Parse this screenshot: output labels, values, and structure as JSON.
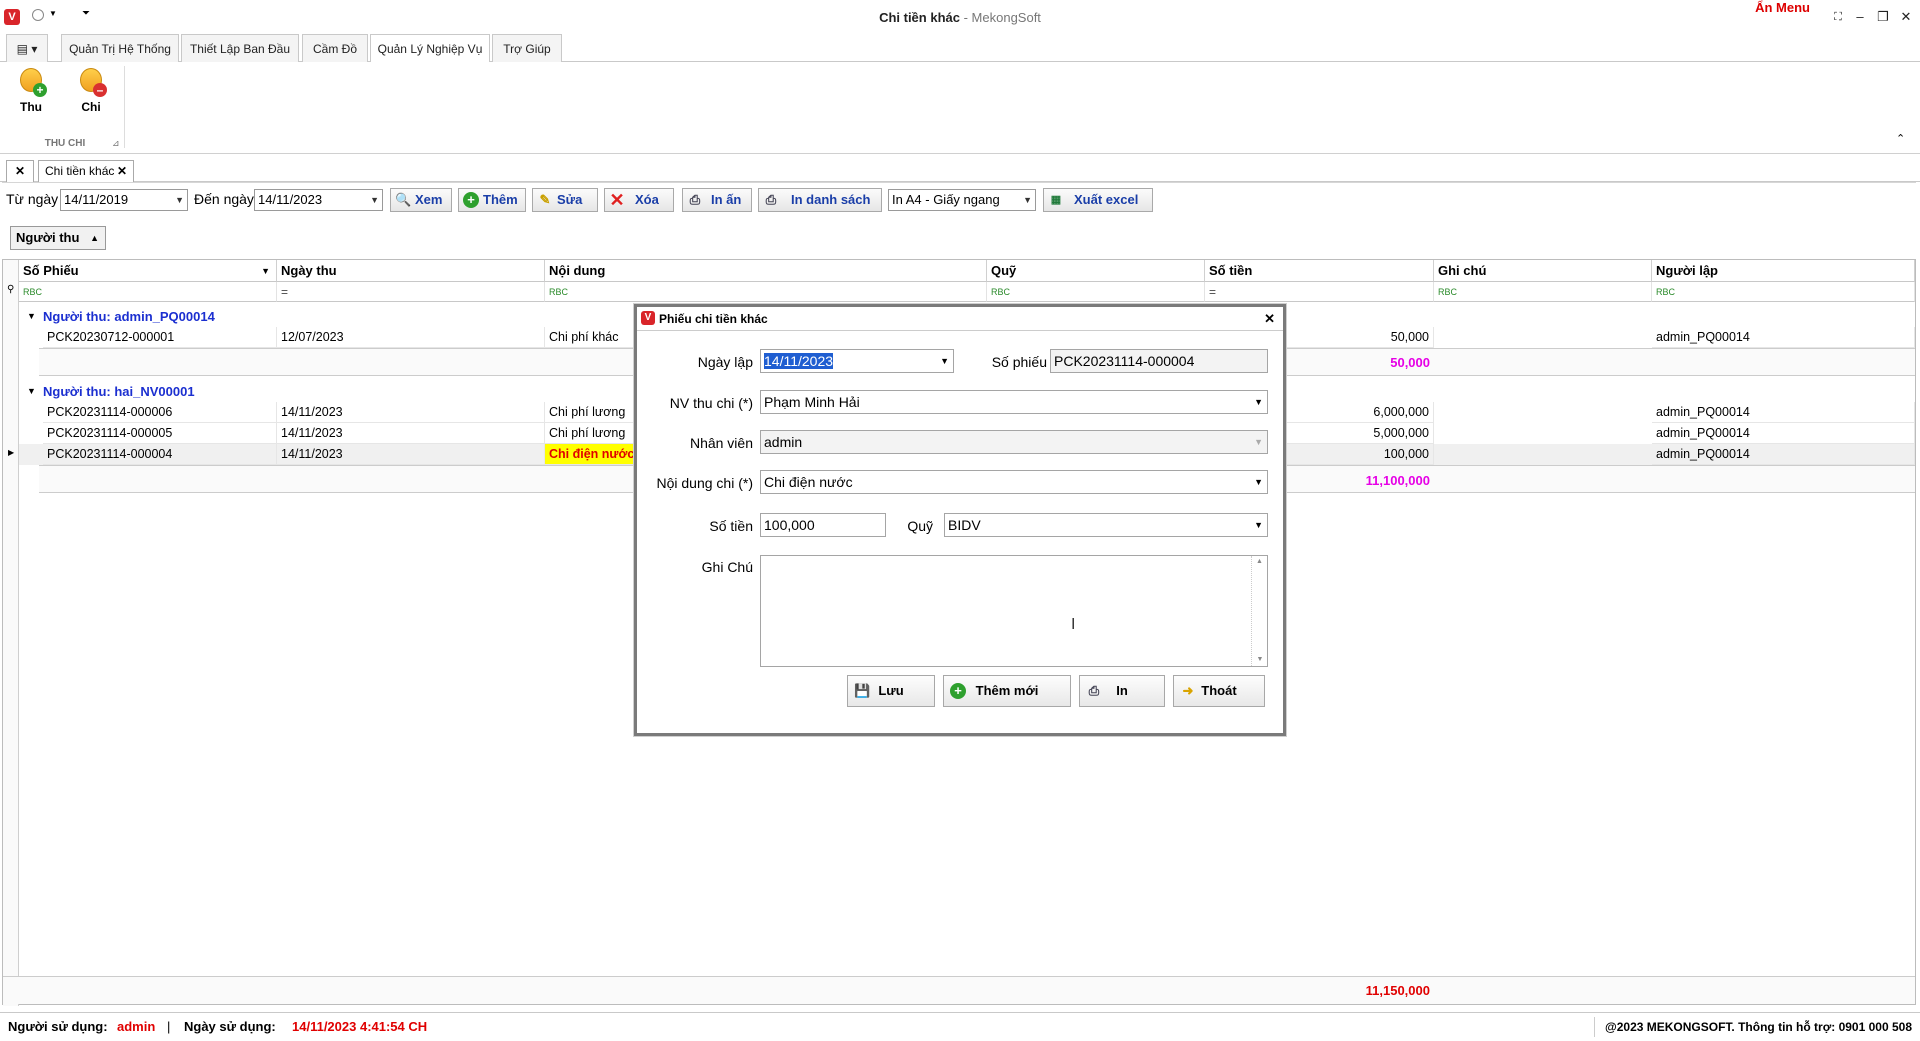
{
  "window": {
    "title": "Chi tiền khác",
    "app_name": "MekongSoft",
    "app_name_sep": " - ",
    "an_menu": "Ẩn Menu",
    "minimize": "–",
    "restore": "❐",
    "close": "✕"
  },
  "ribbon": {
    "tabs": [
      "Quản Trị Hệ Thống",
      "Thiết Lập Ban Đầu",
      "Cầm Đồ",
      "Quản Lý Nghiệp Vụ",
      "Trợ Giúp"
    ],
    "active_tab": "Quản Lý Nghiệp Vụ",
    "buttons": [
      {
        "label": "Thu"
      },
      {
        "label": "Chi"
      }
    ],
    "group_label": "THU CHI"
  },
  "doc_tabs": {
    "active": "Chi tiền khác"
  },
  "toolbar": {
    "from_label": "Từ ngày",
    "from_value": "14/11/2019",
    "to_label": "Đến ngày",
    "to_value": "14/11/2023",
    "xem": "Xem",
    "them": "Thêm",
    "sua": "Sửa",
    "xoa": "Xóa",
    "in_an": "In ấn",
    "in_danh_sach": "In danh sách",
    "print_format": "In A4 - Giấy ngang",
    "xuat_excel": "Xuất excel"
  },
  "group_by": "Người thu",
  "grid": {
    "columns": [
      "Số Phiếu",
      "Ngày thu",
      "Nội dung",
      "Quỹ",
      "Số tiền",
      "Ghi chú",
      "Người lập"
    ],
    "filter_text": "RBC",
    "filter_eq": "=",
    "groups": [
      {
        "title": "Người thu: admin_PQ00014",
        "rows": [
          {
            "so_phieu": "PCK20230712-000001",
            "ngay": "12/07/2023",
            "noi_dung": "Chi phí khác",
            "so_tien": "50,000",
            "nguoi_lap": "admin_PQ00014"
          }
        ],
        "subtotal": "50,000"
      },
      {
        "title": "Người thu: hai_NV00001",
        "rows": [
          {
            "so_phieu": "PCK20231114-000006",
            "ngay": "14/11/2023",
            "noi_dung": "Chi phí lương",
            "so_tien": "6,000,000",
            "nguoi_lap": "admin_PQ00014"
          },
          {
            "so_phieu": "PCK20231114-000005",
            "ngay": "14/11/2023",
            "noi_dung": "Chi phí lương",
            "so_tien": "5,000,000",
            "nguoi_lap": "admin_PQ00014"
          },
          {
            "so_phieu": "PCK20231114-000004",
            "ngay": "14/11/2023",
            "noi_dung": "Chi điện nước",
            "so_tien": "100,000",
            "nguoi_lap": "admin_PQ00014"
          }
        ],
        "subtotal": "11,100,000"
      }
    ],
    "grand_total": "11,150,000"
  },
  "dialog": {
    "title": "Phiếu chi tiền khác",
    "ngay_lap_label": "Ngày lập",
    "ngay_lap": "14/11/2023",
    "so_phieu_label": "Số phiếu",
    "so_phieu": "PCK20231114-000004",
    "nv_label": "NV thu chi (*)",
    "nv": "Phạm Minh Hải",
    "nhan_vien_label": "Nhân viên",
    "nhan_vien": "admin",
    "noi_dung_label": "Nội dung chi (*)",
    "noi_dung": "Chi điện nước",
    "so_tien_label": "Số tiền",
    "so_tien": "100,000",
    "quy_label": "Quỹ",
    "quy": "BIDV",
    "ghi_chu_label": "Ghi Chú",
    "btn_luu": "Lưu",
    "btn_them_moi": "Thêm mới",
    "btn_in": "In",
    "btn_thoat": "Thoát"
  },
  "status": {
    "user_label": "Người sử dụng:",
    "user": "admin",
    "sep": "|",
    "date_label": "Ngày sử dụng:",
    "date": "14/11/2023 4:41:54 CH",
    "copyright": "@2023 MEKONGSOFT. Thông tin hỗ trợ: 0901 000 508"
  },
  "colors": {
    "accent_blue": "#1b2fd0",
    "red": "#e00000",
    "magenta": "#e600e6",
    "highlight_yellow": "#ffff00"
  }
}
